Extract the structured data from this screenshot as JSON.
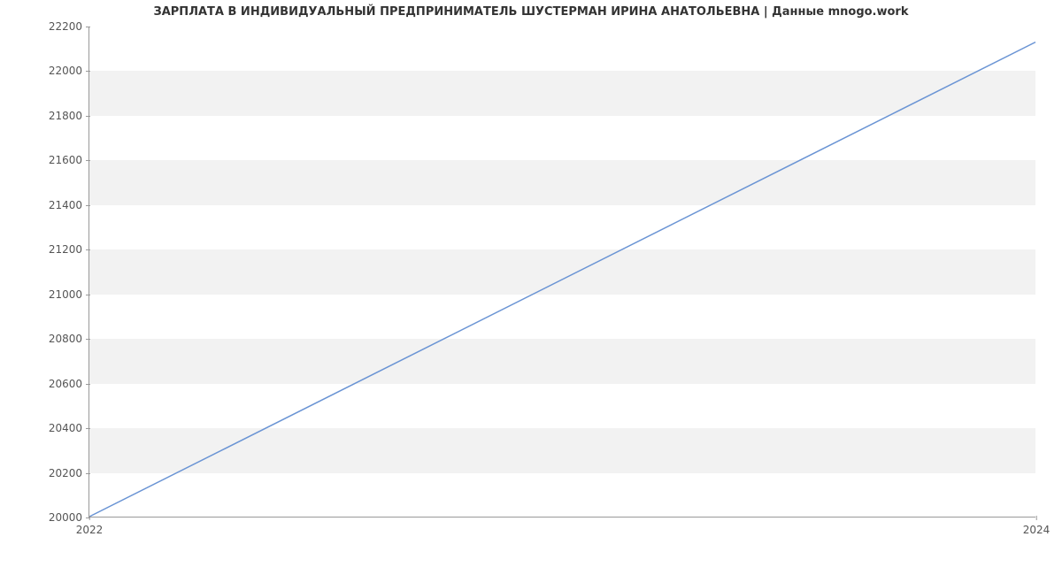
{
  "chart_data": {
    "type": "line",
    "title": "ЗАРПЛАТА В ИНДИВИДУАЛЬНЫЙ ПРЕДПРИНИМАТЕЛЬ  ШУСТЕРМАН ИРИНА АНАТОЛЬЕВНА | Данные mnogo.work",
    "x": [
      2022,
      2024
    ],
    "values": [
      20000,
      22130
    ],
    "xlim": [
      2022,
      2024
    ],
    "ylim": [
      20000,
      22200
    ],
    "x_ticks": [
      2022,
      2024
    ],
    "y_ticks": [
      20000,
      20200,
      20400,
      20600,
      20800,
      21000,
      21200,
      21400,
      21600,
      21800,
      22000,
      22200
    ],
    "line_color": "#6a94d4",
    "band_color": "#f2f2f2"
  }
}
